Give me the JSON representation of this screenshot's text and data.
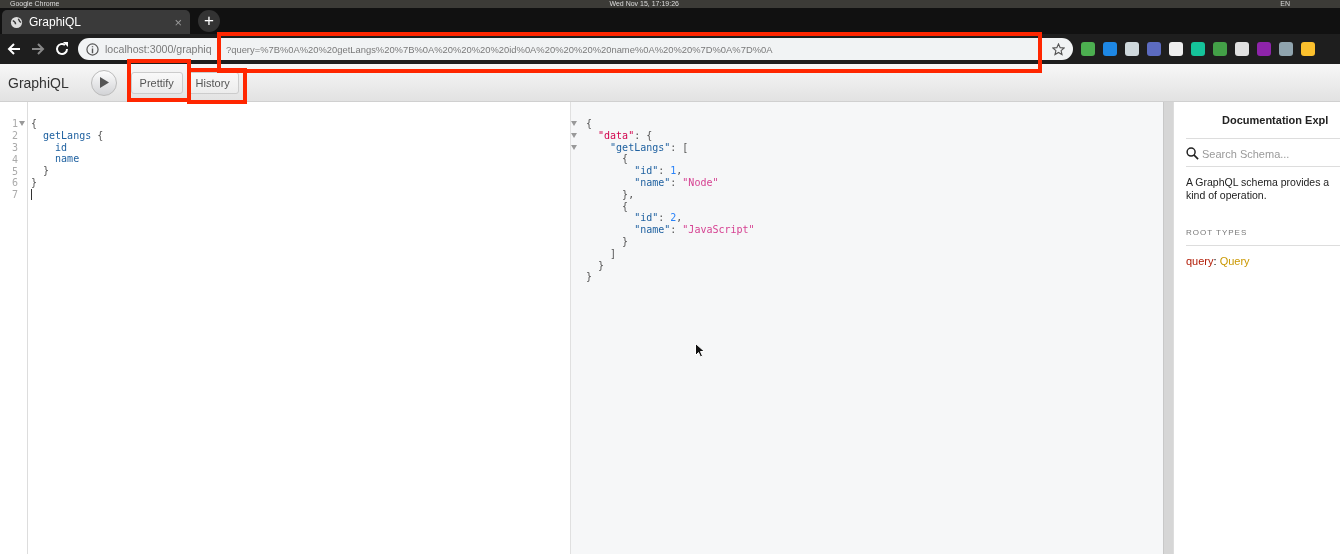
{
  "os_bar": {
    "app": "Google Chrome",
    "clock": "Wed Nov 15, 17:19:26",
    "lang": "EN"
  },
  "browser": {
    "tab": {
      "title": "GraphiQL",
      "close": "×"
    },
    "new_tab": "+",
    "url": "localhost:3000/graphiq",
    "url_rest": "?query=%7B%0A%20%20getLangs%20%7B%0A%20%20%20%20id%0A%20%20%20%20name%0A%20%20%7D%0A%7D%0A"
  },
  "toolbar": {
    "title": "GraphiQL",
    "buttons": [
      "Prettify",
      "History"
    ]
  },
  "query_editor": {
    "lines": [
      {
        "number": "1",
        "fold": true,
        "cursor": false,
        "tokens": [
          {
            "text": "{",
            "kind": "punct"
          }
        ]
      },
      {
        "number": "2",
        "fold": false,
        "cursor": false,
        "tokens": [
          {
            "text": "  getLangs",
            "kind": "field"
          },
          {
            "text": " {",
            "kind": "punct"
          }
        ]
      },
      {
        "number": "3",
        "fold": false,
        "cursor": false,
        "tokens": [
          {
            "text": "    id",
            "kind": "field"
          }
        ]
      },
      {
        "number": "4",
        "fold": false,
        "cursor": false,
        "tokens": [
          {
            "text": "    name",
            "kind": "field"
          }
        ]
      },
      {
        "number": "5",
        "fold": false,
        "cursor": false,
        "tokens": [
          {
            "text": "  }",
            "kind": "punct"
          }
        ]
      },
      {
        "number": "6",
        "fold": false,
        "cursor": false,
        "tokens": [
          {
            "text": "}",
            "kind": "punct"
          }
        ]
      },
      {
        "number": "7",
        "fold": false,
        "cursor": true
      }
    ]
  },
  "result": {
    "lines": [
      {
        "fold": true,
        "tokens": [
          {
            "text": "{",
            "kind": "punct"
          }
        ]
      },
      {
        "fold": true,
        "tokens": [
          {
            "text": "  \"data\"",
            "kind": "key"
          },
          {
            "text": ": {",
            "kind": "punct"
          }
        ]
      },
      {
        "fold": true,
        "tokens": [
          {
            "text": "    \"getLangs\"",
            "kind": "key2"
          },
          {
            "text": ": [",
            "kind": "punct"
          }
        ]
      },
      {
        "fold": false,
        "tokens": [
          {
            "text": "      {",
            "kind": "punct"
          }
        ]
      },
      {
        "fold": false,
        "tokens": [
          {
            "text": "        \"id\"",
            "kind": "key2"
          },
          {
            "text": ": ",
            "kind": "punct"
          },
          {
            "text": "1",
            "kind": "number"
          },
          {
            "text": ",",
            "kind": "punct"
          }
        ]
      },
      {
        "fold": false,
        "tokens": [
          {
            "text": "        \"name\"",
            "kind": "key2"
          },
          {
            "text": ": ",
            "kind": "punct"
          },
          {
            "text": "\"Node\"",
            "kind": "string"
          }
        ]
      },
      {
        "fold": false,
        "tokens": [
          {
            "text": "      },",
            "kind": "punct"
          }
        ]
      },
      {
        "fold": false,
        "tokens": [
          {
            "text": "      {",
            "kind": "punct"
          }
        ]
      },
      {
        "fold": false,
        "tokens": [
          {
            "text": "        \"id\"",
            "kind": "key2"
          },
          {
            "text": ": ",
            "kind": "punct"
          },
          {
            "text": "2",
            "kind": "number"
          },
          {
            "text": ",",
            "kind": "punct"
          }
        ]
      },
      {
        "fold": false,
        "tokens": [
          {
            "text": "        \"name\"",
            "kind": "key2"
          },
          {
            "text": ": ",
            "kind": "punct"
          },
          {
            "text": "\"JavaScript\"",
            "kind": "string"
          }
        ]
      },
      {
        "fold": false,
        "tokens": [
          {
            "text": "      }",
            "kind": "punct"
          }
        ]
      },
      {
        "fold": false,
        "tokens": [
          {
            "text": "    ]",
            "kind": "punct"
          }
        ]
      },
      {
        "fold": false,
        "tokens": [
          {
            "text": "  }",
            "kind": "punct"
          }
        ]
      },
      {
        "fold": false,
        "tokens": [
          {
            "text": "}",
            "kind": "punct"
          }
        ]
      }
    ]
  },
  "docs": {
    "title": "Documentation Expl",
    "search": {
      "placeholder": "Search Schema..."
    },
    "description": [
      "A GraphQL schema provides a",
      "kind of operation."
    ],
    "section": "ROOT TYPES",
    "root": {
      "name": "query",
      "separator": ":",
      "type": "Query"
    }
  }
}
